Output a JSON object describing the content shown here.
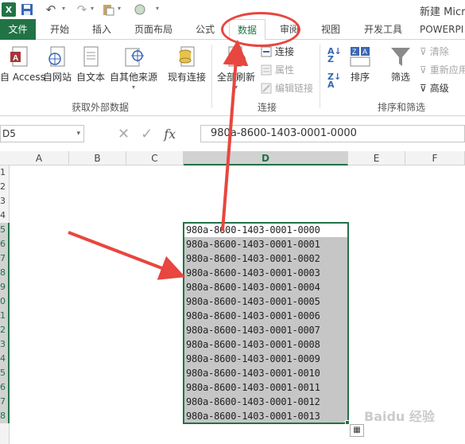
{
  "qat": {
    "excel_logo": "X",
    "title": "新建 Micro"
  },
  "tabs": [
    {
      "label": "文件"
    },
    {
      "label": "开始"
    },
    {
      "label": "插入"
    },
    {
      "label": "页面布局"
    },
    {
      "label": "公式"
    },
    {
      "label": "数据"
    },
    {
      "label": "审阅"
    },
    {
      "label": "视图"
    },
    {
      "label": "开发工具"
    },
    {
      "label": "POWERPI"
    }
  ],
  "ribbon": {
    "get_external": {
      "access": "自 Access",
      "web": "自网站",
      "text": "自文本",
      "other": "自其他来源",
      "existing": "现有连接",
      "label": "获取外部数据"
    },
    "connections": {
      "refresh_all": "全部刷新",
      "conn": "连接",
      "props": "属性",
      "edit_links": "编辑链接",
      "label": "连接"
    },
    "sort_filter": {
      "sort": "排序",
      "filter": "筛选",
      "clear": "清除",
      "reapply": "重新应用",
      "advanced": "高级",
      "label": "排序和筛选"
    }
  },
  "formula_bar": {
    "name_box": "D5",
    "fx": "fx",
    "value": "980a-8600-1403-0001-0000"
  },
  "columns": [
    "A",
    "B",
    "C",
    "D",
    "E",
    "F"
  ],
  "rows": [
    "1",
    "2",
    "3",
    "4",
    "5",
    "6",
    "7",
    "8",
    "9",
    "0",
    "1",
    "2",
    "3",
    "4",
    "5",
    "6",
    "7",
    "8"
  ],
  "cells": [
    "980a-8600-1403-0001-0000",
    "980a-8600-1403-0001-0001",
    "980a-8600-1403-0001-0002",
    "980a-8600-1403-0001-0003",
    "980a-8600-1403-0001-0004",
    "980a-8600-1403-0001-0005",
    "980a-8600-1403-0001-0006",
    "980a-8600-1403-0001-0007",
    "980a-8600-1403-0001-0008",
    "980a-8600-1403-0001-0009",
    "980a-8600-1403-0001-0010",
    "980a-8600-1403-0001-0011",
    "980a-8600-1403-0001-0012",
    "980a-8600-1403-0001-0013"
  ],
  "watermark": "Baidu 经验",
  "colors": {
    "excel_green": "#217346",
    "annotation_red": "#e8463f",
    "selection_gray": "#c6c6c6"
  }
}
